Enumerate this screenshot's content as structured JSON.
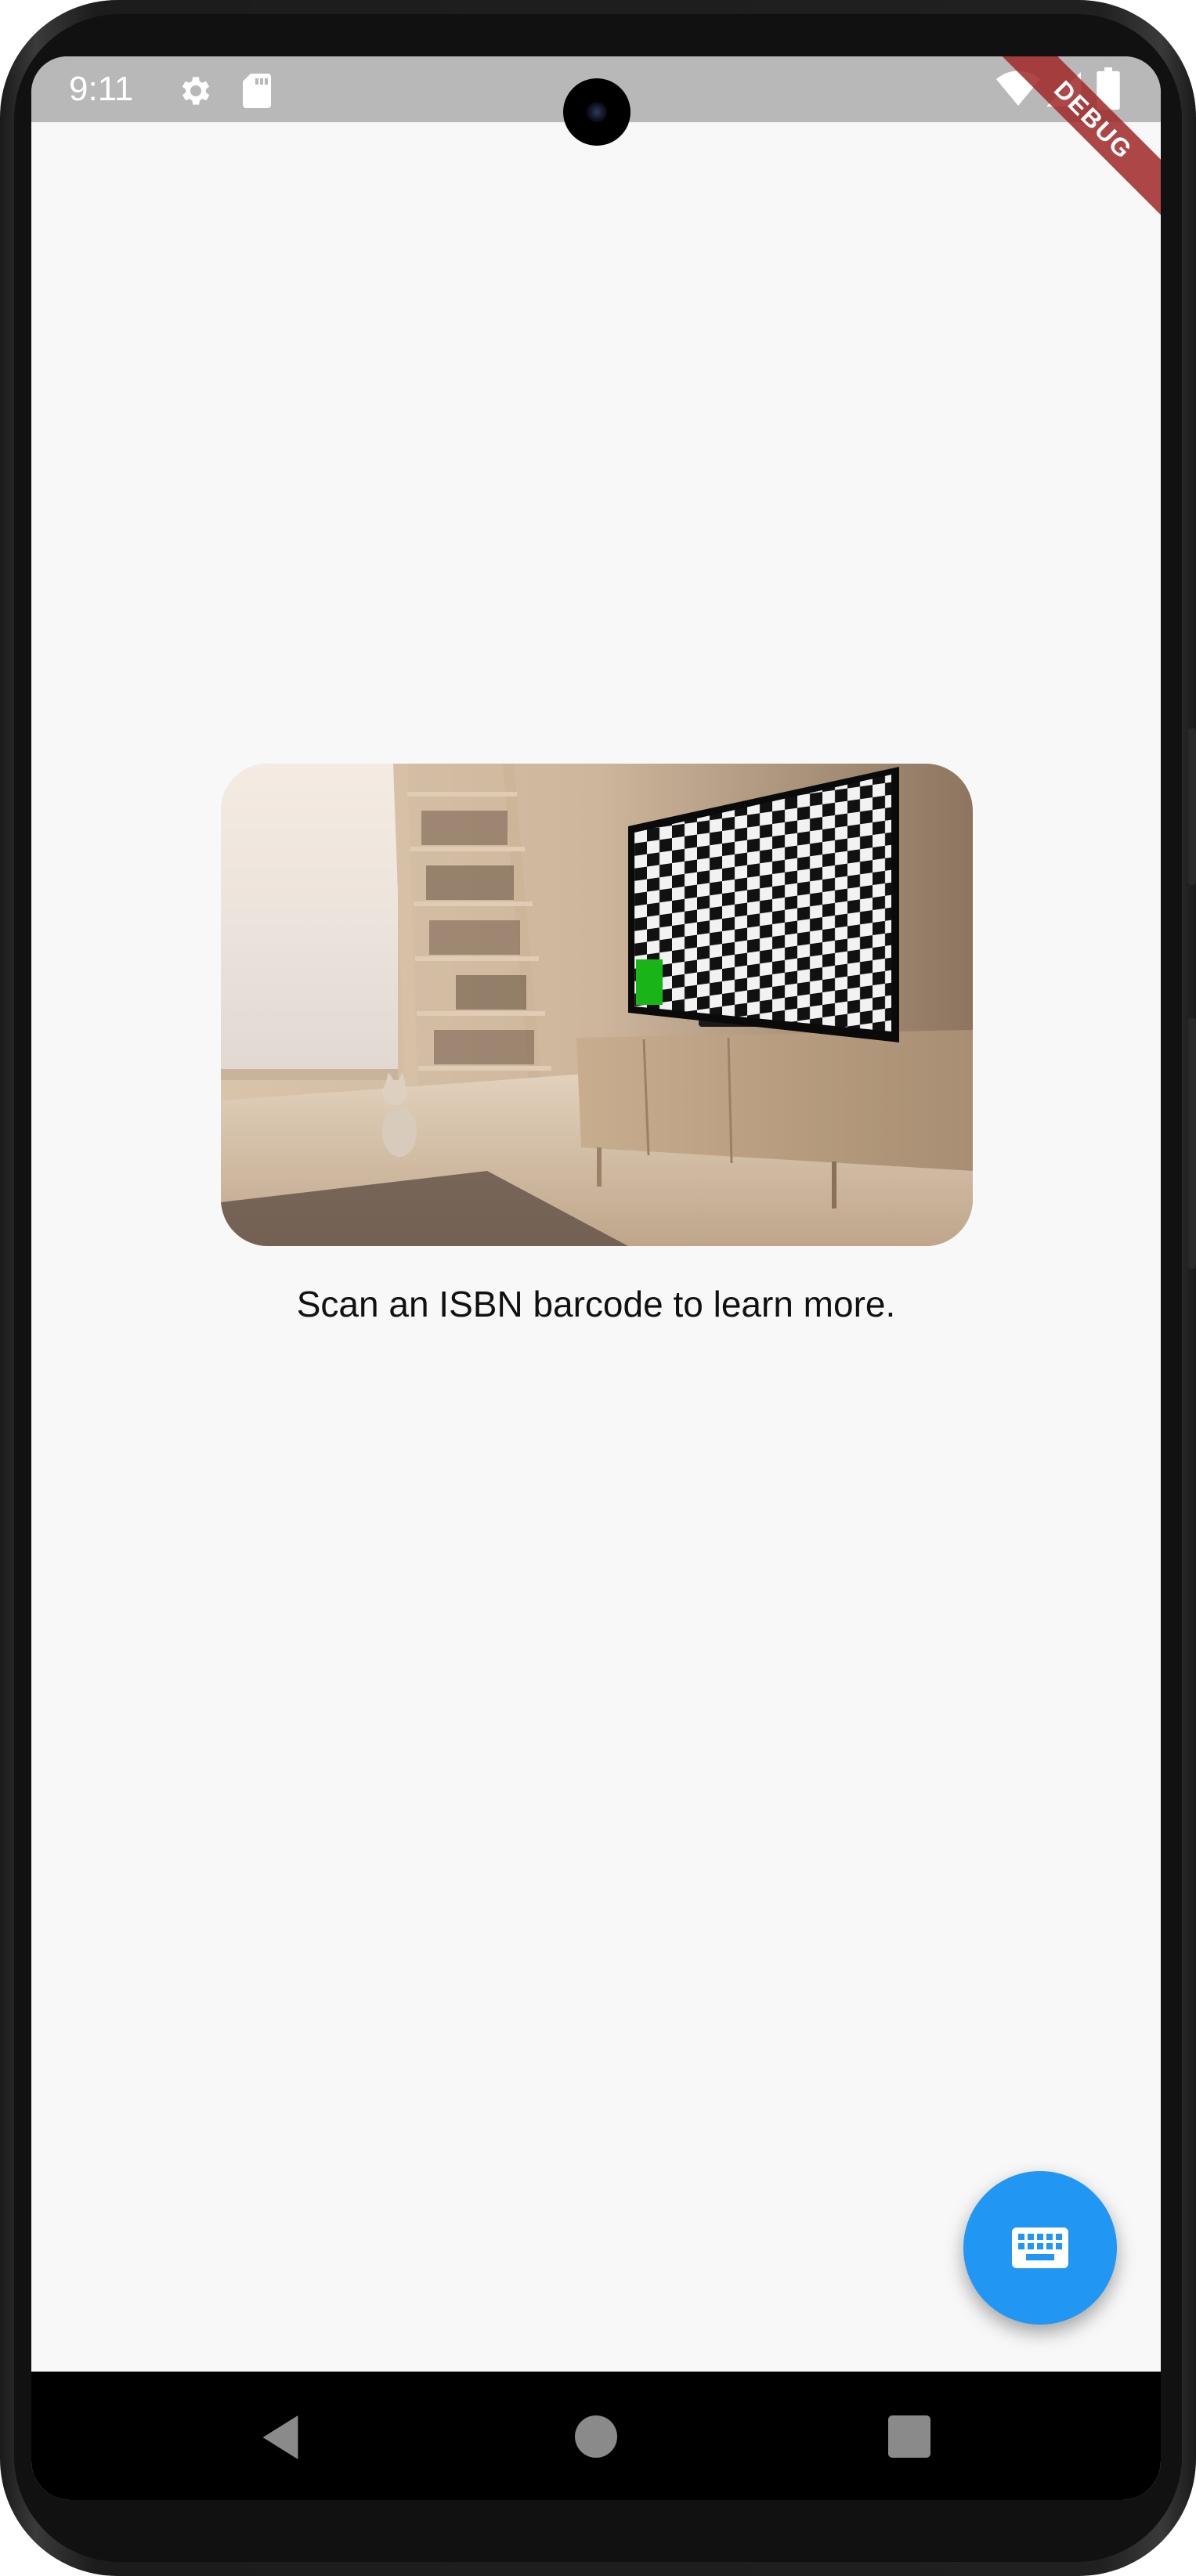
{
  "status_bar": {
    "time": "9:11",
    "icons": [
      "gear-icon",
      "sd-card-icon",
      "wifi-icon",
      "cellular-signal-icon",
      "battery-icon"
    ],
    "background": "#b8b8b8"
  },
  "debug_banner": {
    "label": "DEBUG",
    "color": "#a02828"
  },
  "main": {
    "image_description_icon": "room-with-checkerboard-tv-image",
    "caption": "Scan an ISBN barcode to learn more."
  },
  "fab": {
    "icon": "keyboard-icon",
    "color": "#2196f3"
  },
  "navigation": {
    "back_icon": "back-triangle-icon",
    "home_icon": "home-circle-icon",
    "recents_icon": "recents-square-icon"
  }
}
